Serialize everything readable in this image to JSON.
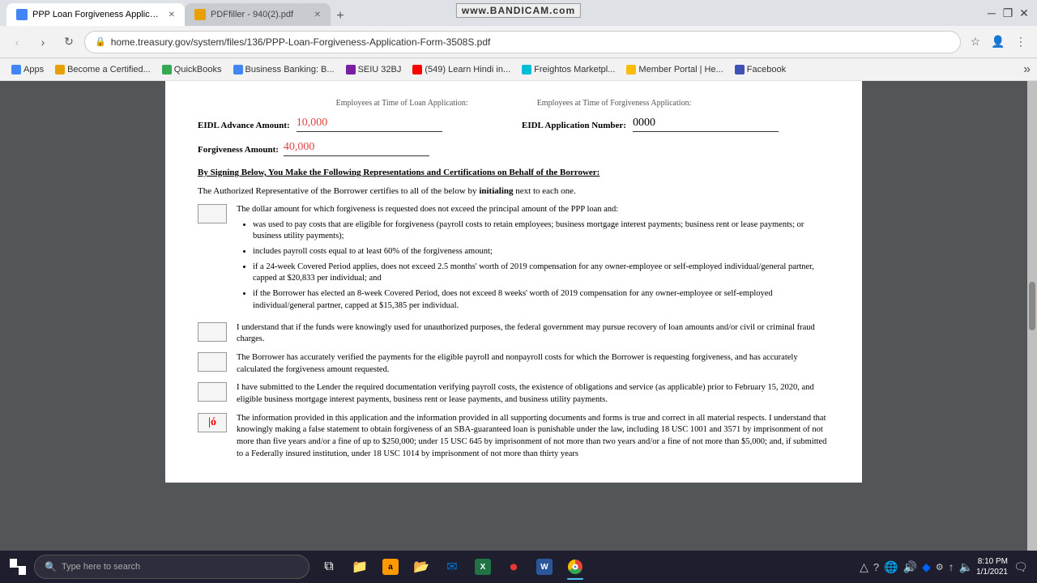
{
  "browser": {
    "tabs": [
      {
        "id": "tab1",
        "favicon_type": "blue",
        "title": "PPP Loan Forgiveness Applicatio...",
        "active": true
      },
      {
        "id": "tab2",
        "favicon_type": "pdf",
        "title": "PDFfiller - 940(2).pdf",
        "active": false
      }
    ],
    "new_tab_symbol": "+",
    "bandicam_text": "www.BANDICAM.com",
    "window_controls": [
      "—",
      "❐",
      "✕"
    ],
    "address": "home.treasury.gov/system/files/136/PPP-Loan-Forgiveness-Application-Form-3508S.pdf",
    "bookmarks": [
      {
        "label": "Apps",
        "favicon_type": "blue"
      },
      {
        "label": "Become a Certified...",
        "favicon_type": "orange"
      },
      {
        "label": "QuickBooks",
        "favicon_type": "green"
      },
      {
        "label": "Business Banking: B...",
        "favicon_type": "blue"
      },
      {
        "label": "SEIU 32BJ",
        "favicon_type": "purple"
      },
      {
        "label": "(549) Learn Hindi in...",
        "favicon_type": "youtube"
      },
      {
        "label": "Freightos Marketpl...",
        "favicon_type": "cyan"
      },
      {
        "label": "Member Portal | He...",
        "favicon_type": "yellow"
      },
      {
        "label": "Facebook",
        "favicon_type": "indigo"
      }
    ]
  },
  "pdf": {
    "fields": {
      "eidl_advance_amount_label": "EIDL Advance Amount:",
      "eidl_advance_amount_value": "10,000",
      "eidl_application_number_label": "EIDL Application Number:",
      "eidl_application_number_value": "0000",
      "forgiveness_amount_label": "Forgiveness Amount:",
      "forgiveness_amount_value": "40,000"
    },
    "heading": "By Signing Below, You Make the Following Representations and Certifications on Behalf of the Borrower:",
    "intro_text": "The Authorized Representative of the Borrower certifies to all of the below by ",
    "intro_bold": "initialing",
    "intro_end": " next to each one.",
    "certifications": [
      {
        "id": "cert1",
        "box_content": "",
        "has_cursor": false,
        "text": "The dollar amount for which forgiveness is requested does not exceed the principal amount of the PPP loan and:",
        "bullets": [
          "was used to pay costs that are eligible for forgiveness (payroll costs to retain employees; business mortgage interest payments; business rent or lease payments; or business utility payments);",
          "includes payroll costs equal to at least 60% of the forgiveness amount;",
          "if a 24-week Covered Period applies, does not exceed 2.5 months' worth of 2019 compensation for any owner-employee or self-employed individual/general partner, capped at $20,833 per individual; and",
          "if the Borrower has elected an 8-week Covered Period, does not exceed 8 weeks' worth of 2019 compensation for any owner-employee or self-employed individual/general partner, capped at $15,385 per individual."
        ]
      },
      {
        "id": "cert2",
        "box_content": "",
        "has_cursor": false,
        "text": "I understand that if the funds were knowingly used for unauthorized purposes, the federal government may pursue recovery of loan amounts and/or civil or criminal fraud charges.",
        "bullets": []
      },
      {
        "id": "cert3",
        "box_content": "",
        "has_cursor": false,
        "text": "The Borrower has accurately verified the payments for the eligible payroll and nonpayroll costs for which the Borrower is requesting forgiveness, and has accurately calculated the forgiveness amount requested.",
        "bullets": []
      },
      {
        "id": "cert4",
        "box_content": "",
        "has_cursor": false,
        "text": "I have submitted to the Lender the required documentation verifying payroll costs, the existence of obligations and service (as applicable) prior to February 15, 2020, and eligible business mortgage interest payments, business rent or lease payments, and business utility payments.",
        "bullets": []
      },
      {
        "id": "cert5",
        "box_content": "",
        "has_cursor": true,
        "cursor_symbol": "ó",
        "text": "The information provided in this application and the information provided in all supporting documents and forms is true and correct in all material respects.  I understand that knowingly making a false statement to obtain forgiveness of an SBA-guaranteed loan is punishable under the law, including 18 USC 1001 and 3571 by imprisonment of not more than five years and/or a fine of up to $250,000; under 15 USC 645 by imprisonment of not more than two years and/or a fine of not more than $5,000; and, if submitted to a Federally insured institution, under 18 USC 1014 by imprisonment of not more than thirty years",
        "bullets": []
      }
    ]
  },
  "taskbar": {
    "search_placeholder": "Type here to search",
    "icons": [
      {
        "name": "task-view",
        "symbol": "⧉"
      },
      {
        "name": "file-explorer",
        "symbol": "📁"
      },
      {
        "name": "amazon",
        "symbol": "🛒"
      },
      {
        "name": "windows-explorer",
        "symbol": "📂"
      },
      {
        "name": "mail",
        "symbol": "✉"
      },
      {
        "name": "excel",
        "symbol": "X"
      },
      {
        "name": "record",
        "symbol": "⏺"
      },
      {
        "name": "word",
        "symbol": "W"
      },
      {
        "name": "chrome",
        "symbol": "●"
      }
    ],
    "system_tray": {
      "icons": [
        "△",
        "🔊",
        "📶",
        "🔋"
      ],
      "time": "8:10 PM",
      "date": "1/1/2021"
    }
  }
}
